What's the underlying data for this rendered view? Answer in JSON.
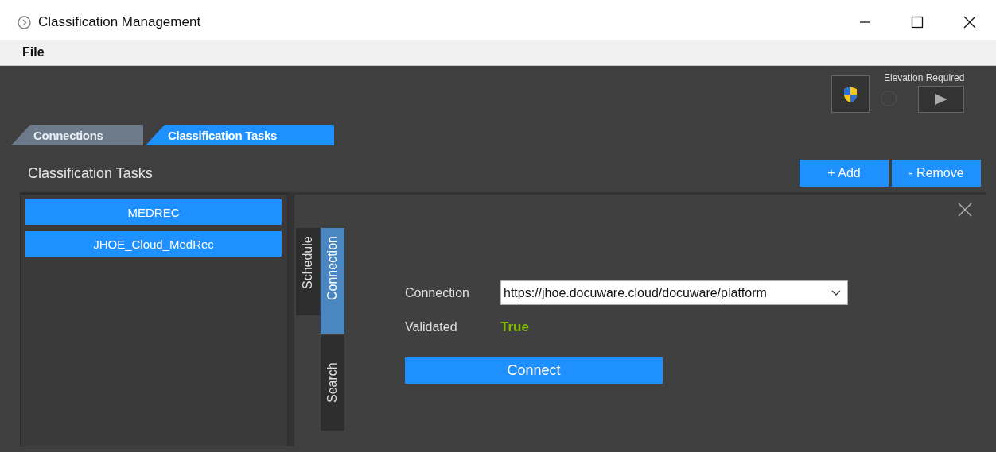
{
  "window": {
    "title": "Classification Management"
  },
  "menu": [
    {
      "label": "File"
    }
  ],
  "elevation": {
    "label": "Elevation Required",
    "checked": false
  },
  "tabs": [
    {
      "label": "Connections",
      "selected": false
    },
    {
      "label": "Classification Tasks",
      "selected": true
    }
  ],
  "section": {
    "title": "Classification Tasks",
    "buttons": [
      "+ Add",
      "- Remove"
    ]
  },
  "tasks": [
    {
      "label": "MEDREC"
    },
    {
      "label": "JHOE_Cloud_MedRec"
    }
  ],
  "detail_tabs": [
    {
      "label": "Schedule",
      "selected": false
    },
    {
      "label": "Connection",
      "selected": true
    },
    {
      "label": "Search",
      "selected": false
    }
  ],
  "form": {
    "connection_label": "Connection",
    "connection_value": "https://jhoe.docuware.cloud/docuware/platform",
    "validated_label": "Validated",
    "validated_value": "True",
    "connect_button": "Connect"
  }
}
